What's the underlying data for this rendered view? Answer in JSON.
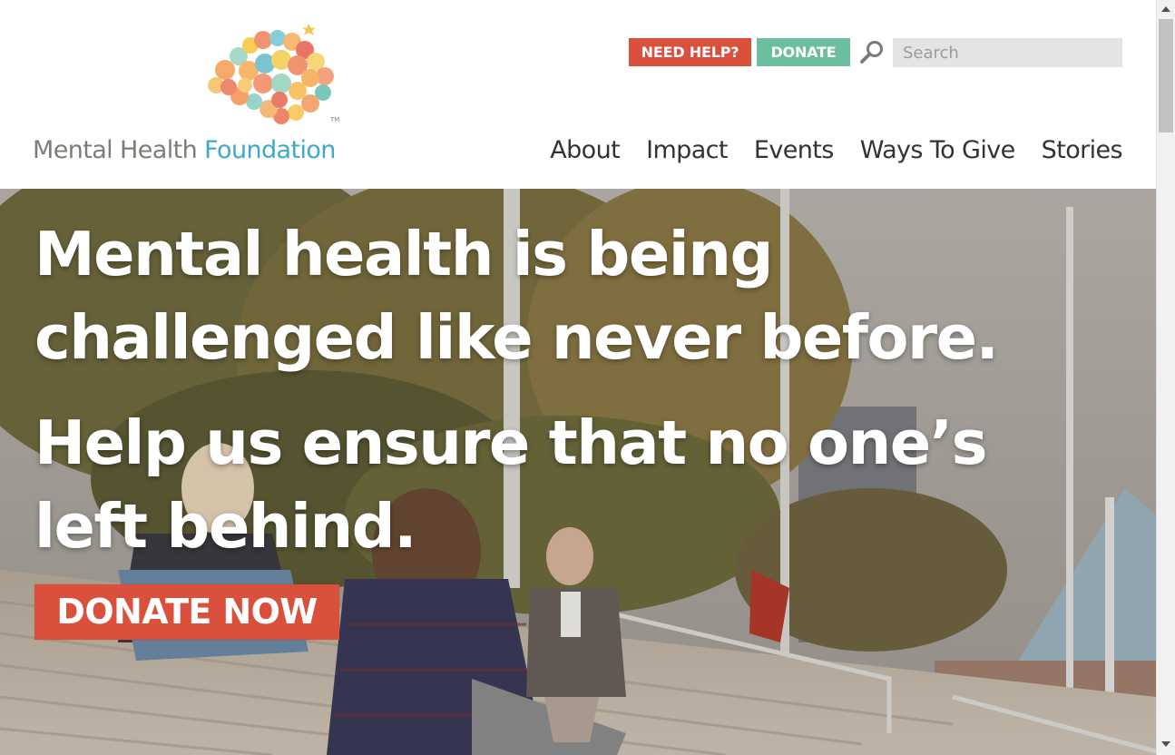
{
  "colors": {
    "accent_red": "#d9503c",
    "accent_green": "#6bbf9f",
    "brand_gray": "#7d7d78",
    "brand_blue": "#3fa9c9"
  },
  "brand": {
    "name_part1": "Mental Health",
    "name_part2": "Foundation",
    "logo_icon": "butterfly-brain-icon"
  },
  "header": {
    "need_help_label": "NEED HELP?",
    "donate_label": "DONATE",
    "search_icon": "search-icon",
    "search_placeholder": "Search"
  },
  "nav": {
    "items": [
      {
        "label": "About"
      },
      {
        "label": "Impact"
      },
      {
        "label": "Events"
      },
      {
        "label": "Ways To Give"
      },
      {
        "label": "Stories"
      }
    ]
  },
  "hero": {
    "line1": "Mental health is being",
    "line2": "challenged like never before.",
    "line3": "Help us ensure that no one’s",
    "line4": "left behind.",
    "cta_label": "DONATE NOW"
  }
}
